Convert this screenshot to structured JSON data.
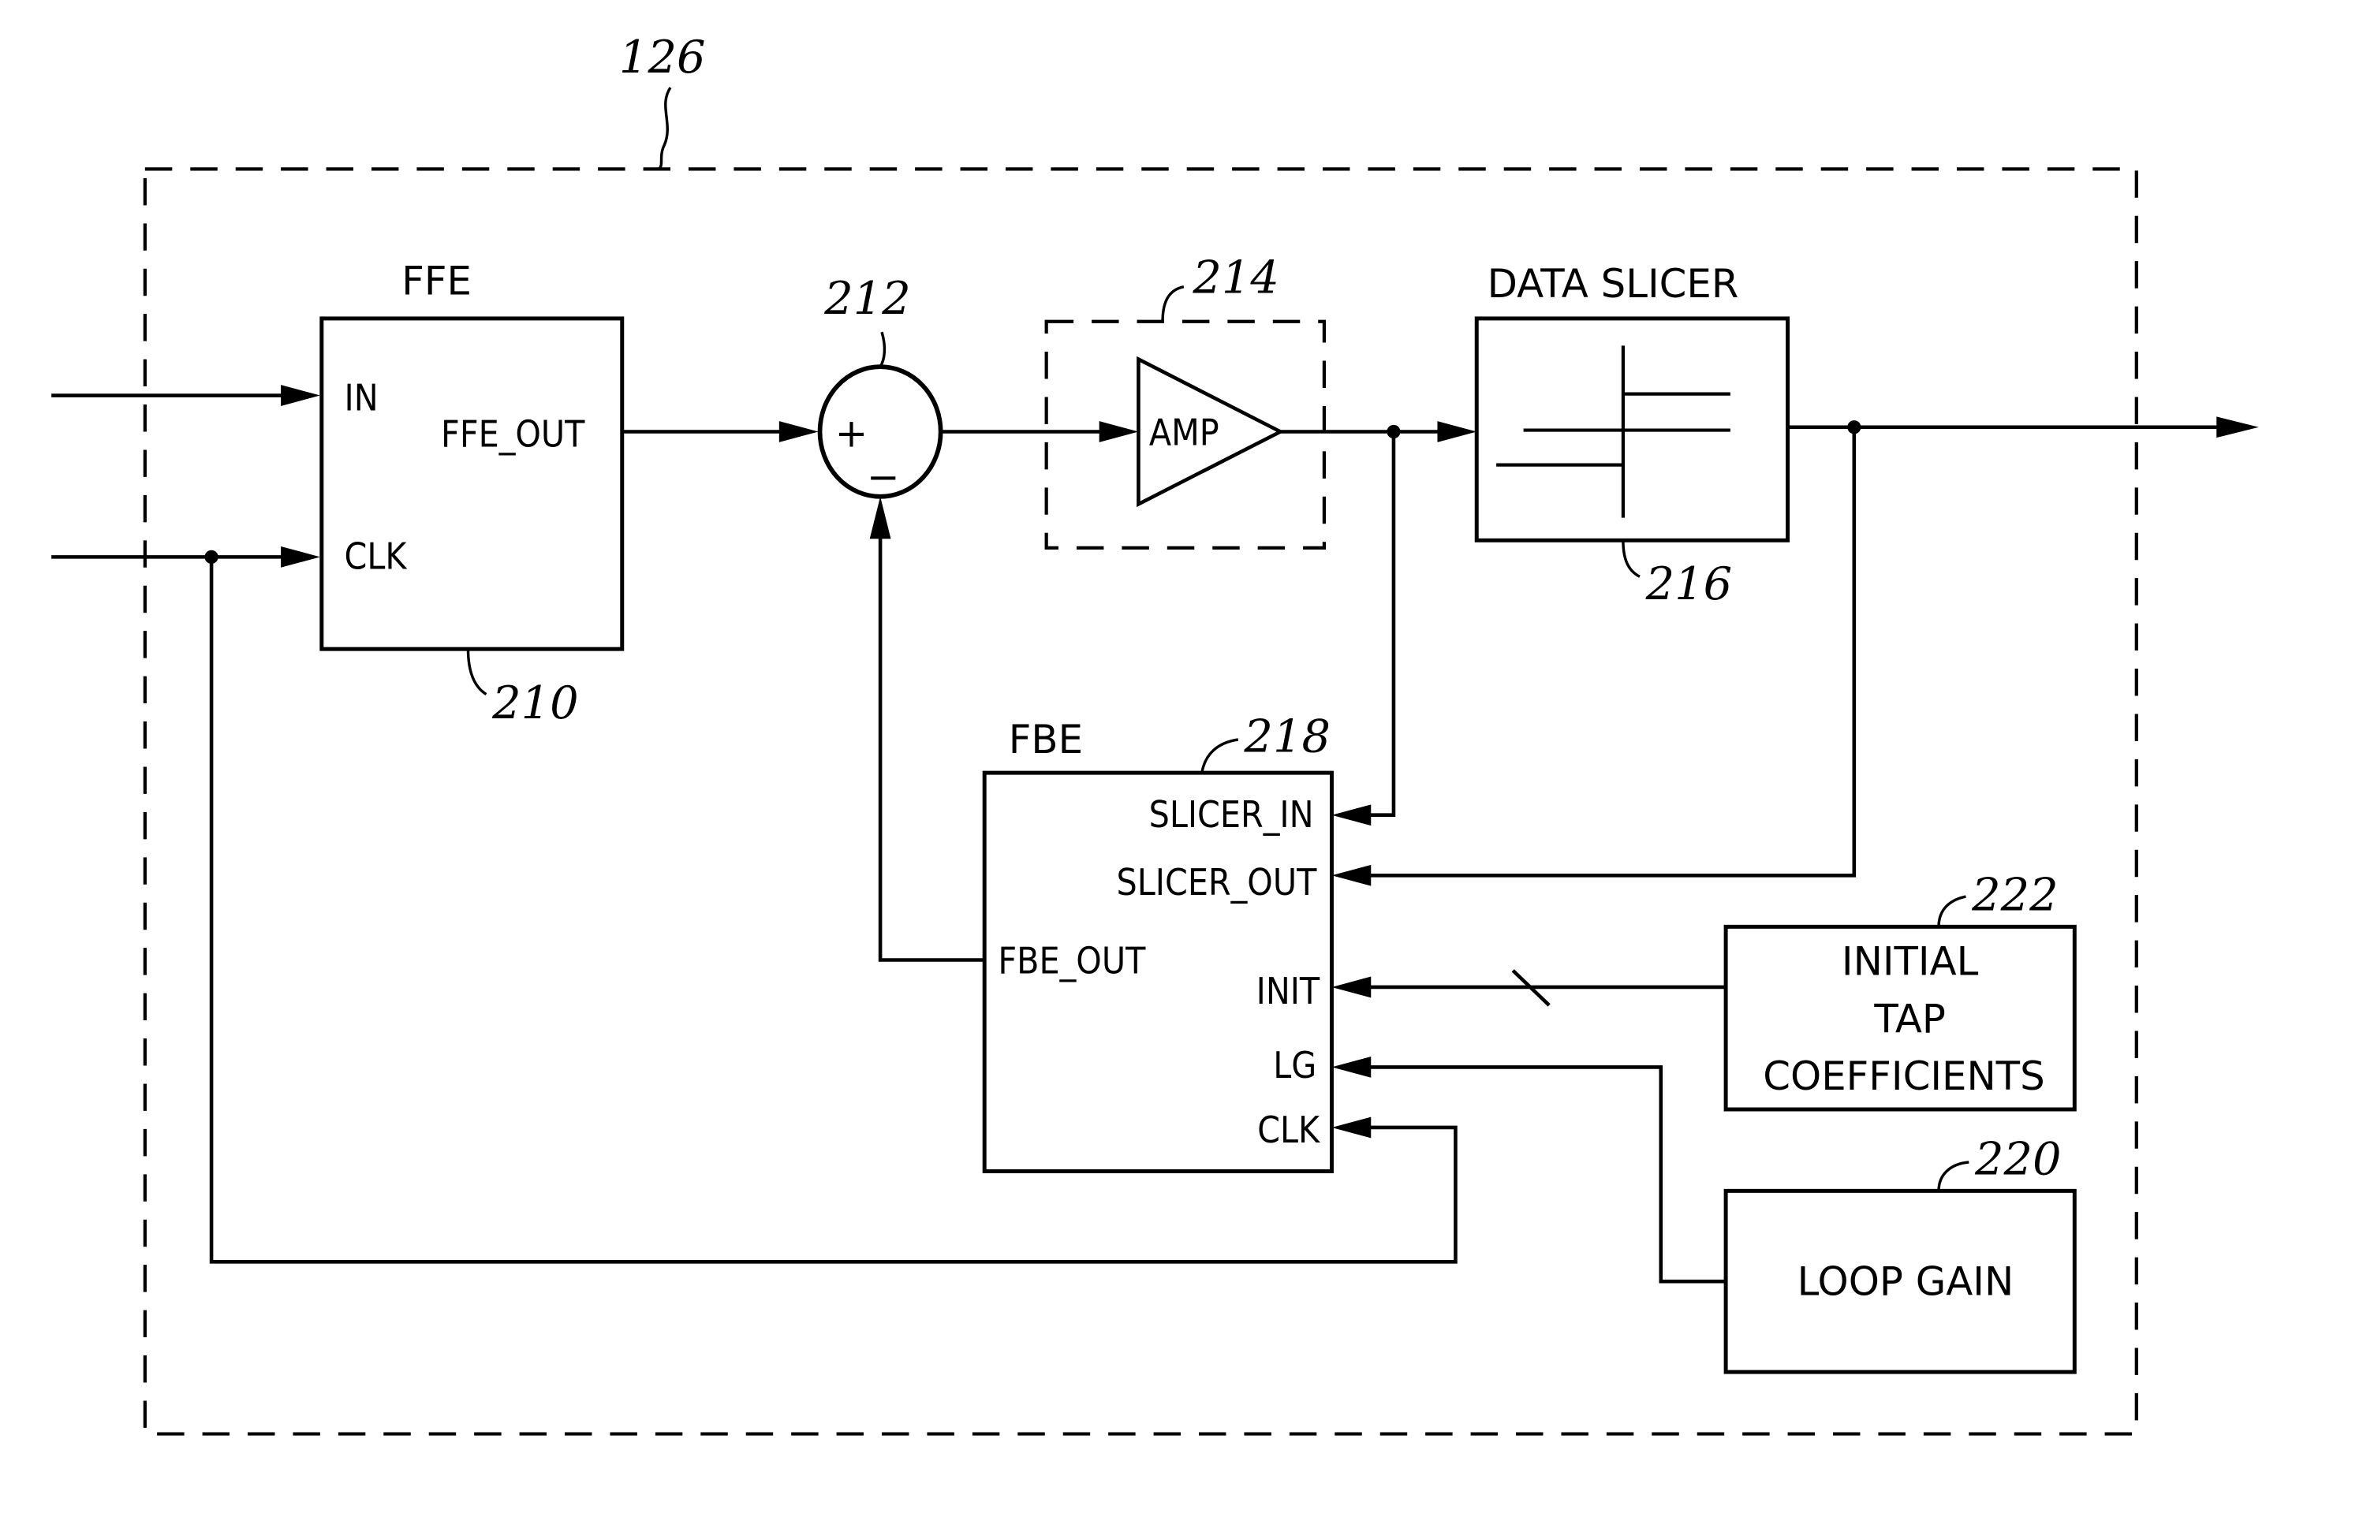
{
  "figure": {
    "outer_ref": "126",
    "blocks": {
      "ffe": {
        "title": "FFE",
        "ref": "210",
        "ports": {
          "in": "IN",
          "out": "FFE_OUT",
          "clk": "CLK"
        }
      },
      "summer": {
        "ref": "212",
        "plus": "+",
        "minus": "−"
      },
      "amp": {
        "label": "AMP",
        "ref": "214"
      },
      "slicer": {
        "title": "DATA  SLICER",
        "ref": "216"
      },
      "fbe": {
        "title": "FBE",
        "ref": "218",
        "ports": {
          "slicer_in": "SLICER_IN",
          "slicer_out": "SLICER_OUT",
          "fbe_out": "FBE_OUT",
          "init": "INIT",
          "lg": "LG",
          "clk": "CLK"
        }
      },
      "initial_tap": {
        "lines": [
          "INITIAL",
          "TAP",
          "COEFFICIENTS"
        ],
        "ref": "222"
      },
      "loop_gain": {
        "label": "LOOP  GAIN",
        "ref": "220"
      }
    }
  }
}
